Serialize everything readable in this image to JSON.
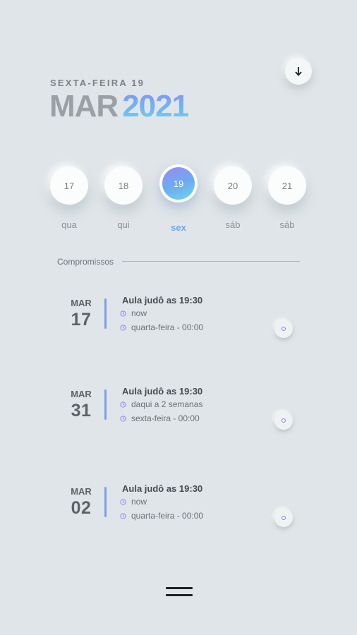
{
  "header": {
    "weekday_label": "SEXTA-FEIRA 19",
    "month": "MAR",
    "year": "2021"
  },
  "download_button": {
    "icon": "arrow-down-icon"
  },
  "days": [
    {
      "number": "17",
      "name": "qua",
      "selected": false
    },
    {
      "number": "18",
      "name": "qui",
      "selected": false
    },
    {
      "number": "19",
      "name": "sex",
      "selected": true
    },
    {
      "number": "20",
      "name": "sáb",
      "selected": false
    },
    {
      "number": "21",
      "name": "sáb",
      "selected": false
    }
  ],
  "section": {
    "title": "Compromissos"
  },
  "events": [
    {
      "month": "MAR",
      "day": "17",
      "title": "Aula judô as 19:30",
      "relative": "now",
      "when": "quarta-feira - 00:00"
    },
    {
      "month": "MAR",
      "day": "31",
      "title": "Aula judô as 19:30",
      "relative": "daqui a 2 semanas",
      "when": "sexta-feira - 00:00"
    },
    {
      "month": "MAR",
      "day": "02",
      "title": "Aula judô as 19:30",
      "relative": "now",
      "when": "quarta-feira - 00:00"
    }
  ],
  "colors": {
    "background": "#dfe5e8",
    "accent_start": "#9b8bf0",
    "accent_end": "#6ad7ee",
    "event_bar": "#7a9fec"
  },
  "bottom": {
    "icon": "menu-handle-icon"
  }
}
